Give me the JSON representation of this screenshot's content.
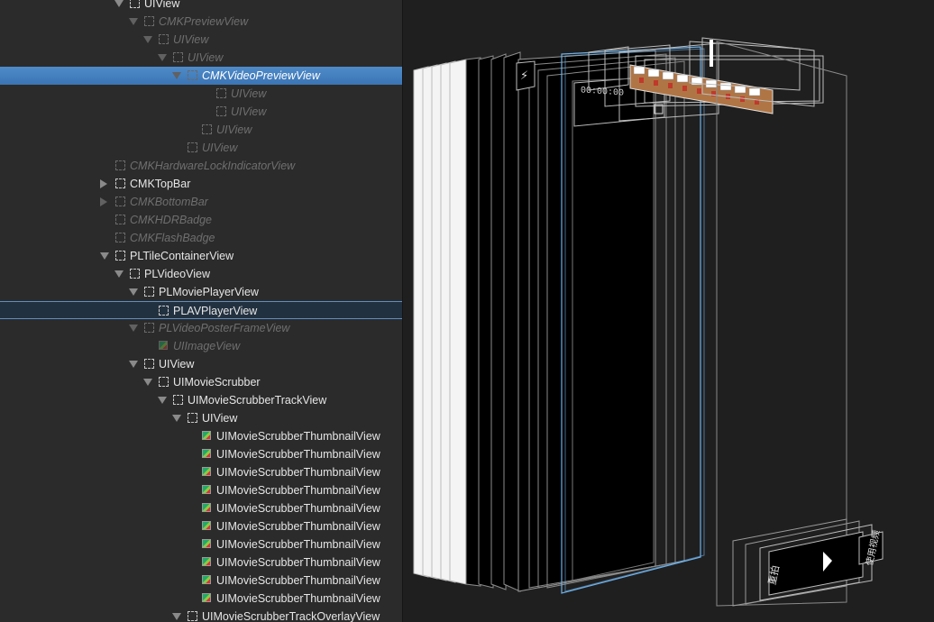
{
  "tree": {
    "rows": [
      {
        "label": "UIView",
        "indent": 9,
        "tri": "down",
        "icon": "box",
        "dim": false
      },
      {
        "label": "CMKPreviewView",
        "indent": 10,
        "tri": "down",
        "icon": "box",
        "dim": true
      },
      {
        "label": "UIView",
        "indent": 11,
        "tri": "down",
        "icon": "box",
        "dim": true
      },
      {
        "label": "UIView",
        "indent": 12,
        "tri": "down",
        "icon": "box",
        "dim": true
      },
      {
        "label": "CMKVideoPreviewView",
        "indent": 13,
        "tri": "down",
        "icon": "box",
        "dim": true,
        "state": "selected"
      },
      {
        "label": "UIView",
        "indent": 15,
        "tri": "none",
        "icon": "box",
        "dim": true
      },
      {
        "label": "UIView",
        "indent": 15,
        "tri": "none",
        "icon": "box",
        "dim": true
      },
      {
        "label": "UIView",
        "indent": 14,
        "tri": "none",
        "icon": "box",
        "dim": true
      },
      {
        "label": "UIView",
        "indent": 13,
        "tri": "none",
        "icon": "box",
        "dim": true
      },
      {
        "label": "CMKHardwareLockIndicatorView",
        "indent": 8,
        "tri": "none",
        "icon": "box",
        "dim": true
      },
      {
        "label": "CMKTopBar",
        "indent": 8,
        "tri": "right",
        "icon": "box",
        "dim": false
      },
      {
        "label": "CMKBottomBar",
        "indent": 8,
        "tri": "right",
        "icon": "box",
        "dim": true
      },
      {
        "label": "CMKHDRBadge",
        "indent": 8,
        "tri": "none",
        "icon": "box",
        "dim": true
      },
      {
        "label": "CMKFlashBadge",
        "indent": 8,
        "tri": "none",
        "icon": "box",
        "dim": true
      },
      {
        "label": "PLTileContainerView",
        "indent": 8,
        "tri": "down",
        "icon": "box",
        "dim": false
      },
      {
        "label": "PLVideoView",
        "indent": 9,
        "tri": "down",
        "icon": "box",
        "dim": false
      },
      {
        "label": "PLMoviePlayerView",
        "indent": 10,
        "tri": "down",
        "icon": "box",
        "dim": false
      },
      {
        "label": "PLAVPlayerView",
        "indent": 11,
        "tri": "none",
        "icon": "box",
        "dim": false,
        "state": "outlined"
      },
      {
        "label": "PLVideoPosterFrameView",
        "indent": 10,
        "tri": "down",
        "icon": "box",
        "dim": true
      },
      {
        "label": "UIImageView",
        "indent": 11,
        "tri": "none",
        "icon": "image",
        "dim": true
      },
      {
        "label": "UIView",
        "indent": 10,
        "tri": "down",
        "icon": "box",
        "dim": false
      },
      {
        "label": "UIMovieScrubber",
        "indent": 11,
        "tri": "down",
        "icon": "box",
        "dim": false
      },
      {
        "label": "UIMovieScrubberTrackView",
        "indent": 12,
        "tri": "down",
        "icon": "box",
        "dim": false
      },
      {
        "label": "UIView",
        "indent": 13,
        "tri": "down",
        "icon": "box",
        "dim": false
      },
      {
        "label": "UIMovieScrubberThumbnailView",
        "indent": 14,
        "tri": "none",
        "icon": "image",
        "dim": false
      },
      {
        "label": "UIMovieScrubberThumbnailView",
        "indent": 14,
        "tri": "none",
        "icon": "image",
        "dim": false
      },
      {
        "label": "UIMovieScrubberThumbnailView",
        "indent": 14,
        "tri": "none",
        "icon": "image",
        "dim": false
      },
      {
        "label": "UIMovieScrubberThumbnailView",
        "indent": 14,
        "tri": "none",
        "icon": "image",
        "dim": false
      },
      {
        "label": "UIMovieScrubberThumbnailView",
        "indent": 14,
        "tri": "none",
        "icon": "image",
        "dim": false
      },
      {
        "label": "UIMovieScrubberThumbnailView",
        "indent": 14,
        "tri": "none",
        "icon": "image",
        "dim": false
      },
      {
        "label": "UIMovieScrubberThumbnailView",
        "indent": 14,
        "tri": "none",
        "icon": "image",
        "dim": false
      },
      {
        "label": "UIMovieScrubberThumbnailView",
        "indent": 14,
        "tri": "none",
        "icon": "image",
        "dim": false
      },
      {
        "label": "UIMovieScrubberThumbnailView",
        "indent": 14,
        "tri": "none",
        "icon": "image",
        "dim": false
      },
      {
        "label": "UIMovieScrubberThumbnailView",
        "indent": 14,
        "tri": "none",
        "icon": "image",
        "dim": false
      },
      {
        "label": "UIMovieScrubberTrackOverlayView",
        "indent": 13,
        "tri": "down",
        "icon": "box",
        "dim": false
      }
    ]
  },
  "canvas": {
    "timestamp": "00:00:00",
    "retake_label": "重拍",
    "use_video_label": "使用视频"
  },
  "colors": {
    "selection": "#3b74b5",
    "panel_bg": "#2b2b2b",
    "canvas_bg": "#1f1f1f",
    "layer_stroke": "#9a9a9a",
    "highlight_stroke": "#6fb0e8"
  },
  "icons": [
    "disclosure-triangle-icon",
    "view-placeholder-icon",
    "image-view-icon",
    "flash-icon",
    "camera-flip-icon",
    "play-icon"
  ]
}
